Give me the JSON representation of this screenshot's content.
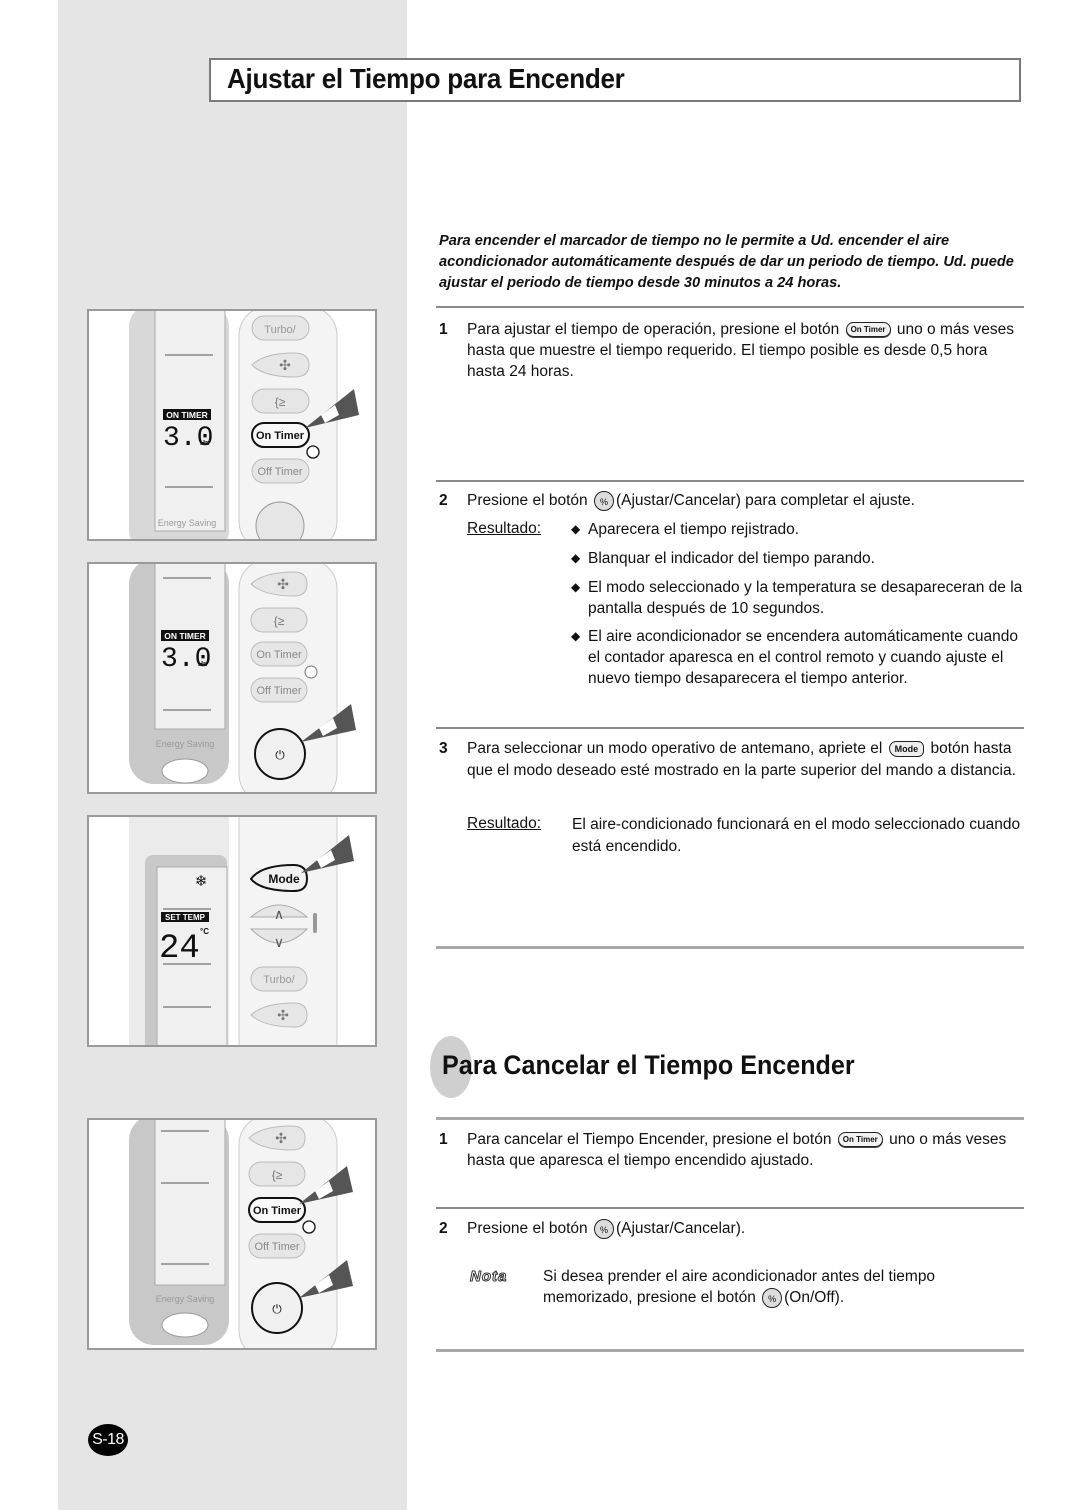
{
  "page": {
    "title": "Ajustar el Tiempo para Encender",
    "intro": "Para encender el marcador de tiempo no le permite a Ud. encender el aire acondicionador automáticamente después de dar un periodo de tiempo. Ud. puede ajustar el periodo de tiempo desde 30 minutos a 24 horas.",
    "page_number": "S-18"
  },
  "section1": {
    "steps": [
      {
        "num": "1",
        "text_before": "Para ajustar el tiempo de operación, presione el botón",
        "button": "On Timer",
        "text_after": "uno o más veses hasta que muestre el tiempo requerido. El tiempo posible es desde 0,5 hora hasta 24 horas."
      },
      {
        "num": "2",
        "text_before": "Presione el botón",
        "button": "Set/Cancel",
        "text_after": "(Ajustar/Cancelar) para completar el ajuste.",
        "result_label": "Resultado:",
        "bullets": [
          "Aparecera el tiempo rejistrado.",
          "Blanquar el indicador del tiempo parando.",
          "El modo seleccionado y la temperatura se desapareceran de la pantalla después de 10 segundos.",
          "El aire acondicionador se encendera automáticamente cuando el contador aparesca en el control remoto y cuando ajuste el nuevo tiempo desaparecera el tiempo anterior."
        ]
      },
      {
        "num": "3",
        "text_before": "Para seleccionar un modo operativo de antemano, apriete el",
        "button": "Mode",
        "text_after": "botón hasta que el modo deseado esté mostrado en la parte superior del mando a distancia.",
        "result_label": "Resultado:",
        "result_text": "El aire-condicionado funcionará en el modo seleccionado cuando está encendido."
      }
    ]
  },
  "section2": {
    "title": "Para Cancelar el Tiempo Encender",
    "steps": [
      {
        "num": "1",
        "text_before": "Para cancelar el Tiempo Encender, presione el botón",
        "button": "On Timer",
        "text_after": "uno o más veses hasta que aparesca el tiempo encendido ajustado."
      },
      {
        "num": "2",
        "text_before": "Presione el botón",
        "button": "Set/Cancel",
        "text_after": "(Ajustar/Cancelar)."
      }
    ],
    "note_label": "Nota",
    "note_before": "Si desea prender el aire acondicionador antes del tiempo memorizado, presione el botón",
    "note_button": "On/Off",
    "note_after": "(On/Off)."
  },
  "remotes": [
    {
      "display_label": "ON TIMER",
      "display_value": "3.0",
      "display_unit": "Hr.",
      "energy_label": "Energy Saving",
      "buttons": [
        "Turbo/",
        "fan",
        "swing",
        "On Timer",
        "Off Timer",
        "Set/Cancel"
      ],
      "highlighted": "On Timer"
    },
    {
      "display_label": "ON TIMER",
      "display_value": "3.0",
      "display_unit": "Hr.",
      "energy_label": "Energy Saving",
      "buttons": [
        "fan",
        "swing",
        "On Timer",
        "Off Timer",
        "Set/Cancel"
      ],
      "highlighted": "Set/Cancel"
    },
    {
      "display_label": "SET TEMP",
      "display_value": "24",
      "display_unit": "°C",
      "mode_icon": "snowflake",
      "buttons": [
        "Mode",
        "up",
        "down",
        "Turbo/",
        "fan"
      ],
      "highlighted": "Mode"
    },
    {
      "energy_label": "Energy Saving",
      "buttons": [
        "fan",
        "swing",
        "On Timer",
        "Off Timer",
        "Set/Cancel"
      ],
      "highlighted": "On Timer, Set/Cancel"
    }
  ],
  "icons": {
    "diamond": "◆",
    "setcancel_glyph": "%",
    "snowflake": "❄"
  }
}
